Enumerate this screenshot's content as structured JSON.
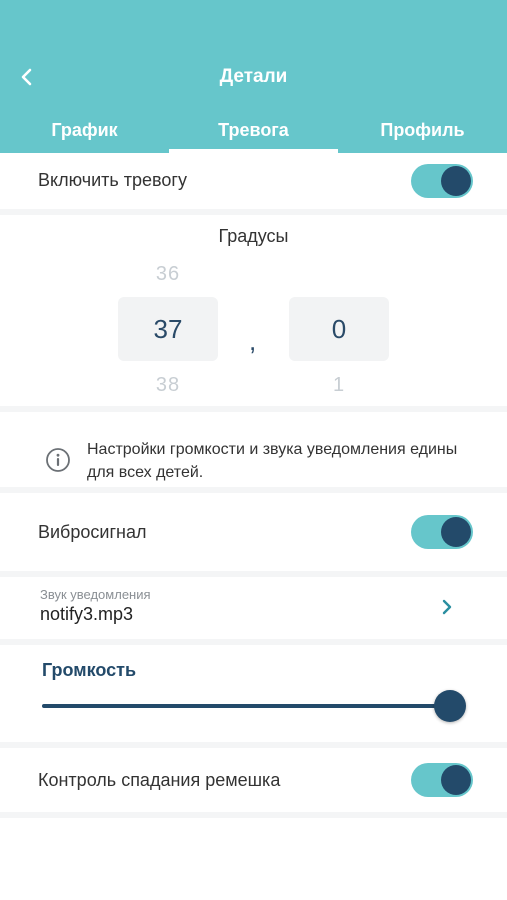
{
  "header": {
    "title": "Детали",
    "back_icon": "chevron-left-icon",
    "tabs": [
      {
        "label": "График",
        "active": false
      },
      {
        "label": "Тревога",
        "active": true
      },
      {
        "label": "Профиль",
        "active": false
      }
    ]
  },
  "alarm": {
    "enable_label": "Включить тревогу",
    "enabled": true
  },
  "degrees": {
    "title": "Градусы",
    "integer": {
      "prev": "36",
      "current": "37",
      "next": "38"
    },
    "separator": ",",
    "decimal": {
      "prev": "",
      "current": "0",
      "next": "1"
    }
  },
  "info": {
    "icon": "info-icon",
    "text": "Настройки громкости и звука уведомления едины для всех детей."
  },
  "vibration": {
    "label": "Вибросигнал",
    "enabled": true
  },
  "sound": {
    "label": "Звук уведомления",
    "value": "notify3.mp3",
    "icon": "chevron-right-icon"
  },
  "volume": {
    "label": "Громкость",
    "level_percent": 100
  },
  "strap": {
    "label": "Контроль спадания ремешка",
    "enabled": true
  },
  "colors": {
    "header": "#66c6cb",
    "toggle_track": "#66c6cb",
    "accent_dark": "#234a6a"
  }
}
